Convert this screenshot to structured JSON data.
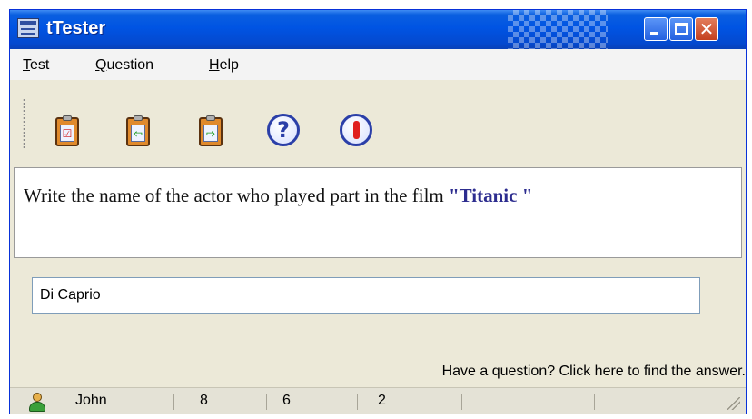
{
  "window": {
    "title": "tTester",
    "controls": {
      "minimize_icon": "minimize-icon",
      "maximize_icon": "maximize-icon",
      "close_label": "✕"
    }
  },
  "menu": {
    "items": [
      {
        "hotkey": "T",
        "rest": "est"
      },
      {
        "hotkey": "Q",
        "rest": "uestion"
      },
      {
        "hotkey": "H",
        "rest": "elp"
      }
    ]
  },
  "toolbar": {
    "buttons": [
      {
        "icon": "clipboard-check-icon",
        "glyph": "☑"
      },
      {
        "icon": "clipboard-previous-icon",
        "glyph": "⇦"
      },
      {
        "icon": "clipboard-next-icon",
        "glyph": "⇨"
      },
      {
        "icon": "help-circle-icon",
        "glyph": "?"
      },
      {
        "icon": "exit-circle-icon",
        "glyph": ""
      }
    ]
  },
  "question": {
    "text": "Write the name of the actor who played part in the film ",
    "film_open_quote": "\"",
    "film_title": "Titanic",
    "film_close_quote": " \"",
    "film_color": "#2d2d8f"
  },
  "answer": {
    "value": "Di Caprio"
  },
  "help_link": "Have a question? Click here to find the answer.",
  "status": {
    "user": "John",
    "field1": "8",
    "field2": "6",
    "field3": "2"
  },
  "colors": {
    "titlebar": "#0054e3",
    "window_bg": "#ece9d8",
    "accent": "#2b3fa8",
    "exit_red": "#e02020"
  }
}
